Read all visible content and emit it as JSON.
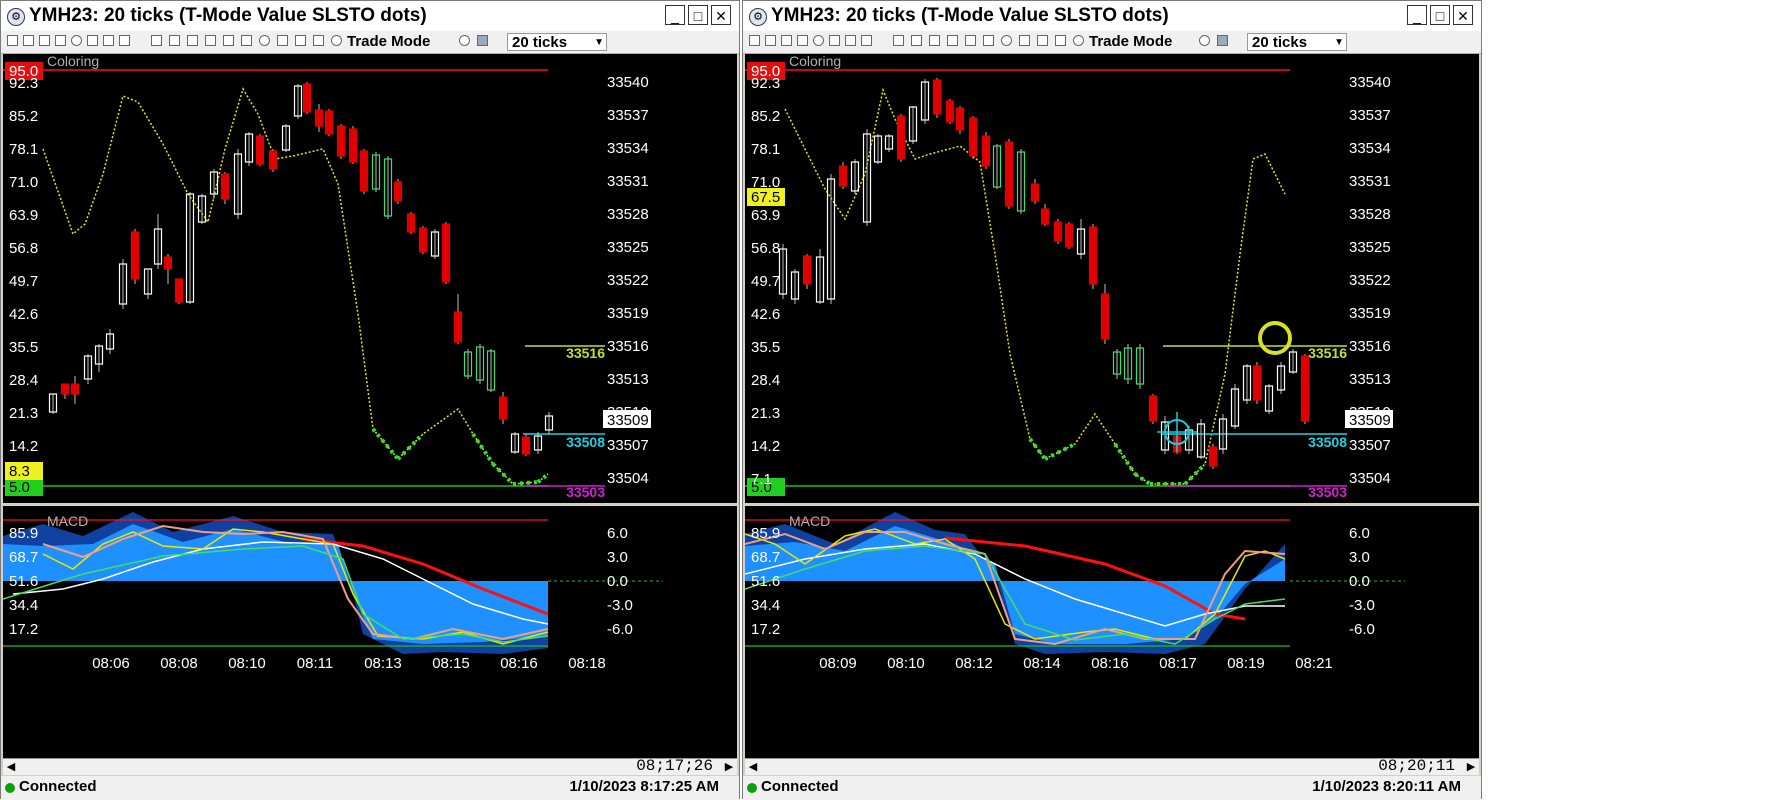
{
  "windows": [
    {
      "title": "YMH23: 20 ticks (T-Mode Value SLSTO dots)",
      "toolbar": {
        "mode_label": "Trade Mode",
        "interval": "20 ticks"
      },
      "price_panel": {
        "indicator_label": "Coloring",
        "left_axis_labels": [
          "92.3",
          "85.2",
          "78.1",
          "71.0",
          "63.9",
          "56.8",
          "49.7",
          "42.6",
          "35.5",
          "28.4",
          "21.3",
          "14.2"
        ],
        "right_axis_labels": [
          "33540",
          "33537",
          "33534",
          "33531",
          "33528",
          "33525",
          "33522",
          "33519",
          "33516",
          "33513",
          "33510",
          "33507",
          "33504"
        ],
        "upper_level_badge": "95.0",
        "lower_level_badge": "5.0",
        "current_osc_badge": "8.3",
        "last_price_badge": "33509",
        "level_line_labels": {
          "high": "33516",
          "mid": "33508",
          "low": "33503"
        }
      },
      "macd_panel": {
        "label": "MACD",
        "left_axis_labels": [
          "85.9",
          "68.7",
          "51.6",
          "34.4",
          "17.2"
        ],
        "right_axis_labels": [
          "6.0",
          "3.0",
          "0.0",
          "-3.0",
          "-6.0"
        ]
      },
      "time_axis_labels": [
        "08:06",
        "08:08",
        "08:10",
        "08:11",
        "08:13",
        "08:15",
        "08:16",
        "08:18"
      ],
      "scroll_time": "08;17;26",
      "status": {
        "connection": "Connected",
        "datetime": "1/10/2023 8:17:25 AM"
      }
    },
    {
      "title": "YMH23: 20 ticks (T-Mode Value SLSTO dots)",
      "toolbar": {
        "mode_label": "Trade Mode",
        "interval": "20 ticks"
      },
      "price_panel": {
        "indicator_label": "Coloring",
        "left_axis_labels": [
          "92.3",
          "85.2",
          "78.1",
          "71.0",
          "63.9",
          "56.8",
          "49.7",
          "42.6",
          "35.5",
          "28.4",
          "21.3",
          "14.2",
          "7.1"
        ],
        "right_axis_labels": [
          "33540",
          "33537",
          "33534",
          "33531",
          "33528",
          "33525",
          "33522",
          "33519",
          "33516",
          "33513",
          "33510",
          "33507",
          "33504"
        ],
        "upper_level_badge": "95.0",
        "lower_level_badge": "5.0",
        "current_osc_badge": "67.5",
        "last_price_badge": "33509",
        "level_line_labels": {
          "high": "33516",
          "mid": "33508",
          "low": "33503"
        }
      },
      "macd_panel": {
        "label": "MACD",
        "left_axis_labels": [
          "85.9",
          "68.7",
          "51.6",
          "34.4",
          "17.2"
        ],
        "right_axis_labels": [
          "6.0",
          "3.0",
          "0.0",
          "-3.0",
          "-6.0"
        ]
      },
      "time_axis_labels": [
        "08:09",
        "08:10",
        "08:12",
        "08:14",
        "08:16",
        "08:17",
        "08:19",
        "08:21"
      ],
      "scroll_time": "08;20;11",
      "status": {
        "connection": "Connected",
        "datetime": "1/10/2023 8:20:11 AM"
      }
    }
  ],
  "colors": {
    "chart_bg": "#000000",
    "up_candle": "#ffffff",
    "down_candle": "#e00000",
    "green_candle": "#40e070",
    "stoch_line": "#e8e800",
    "stoch_dots_oversold": "#30e030",
    "level_high": "#c0e030",
    "level_mid": "#20d0e0",
    "level_low": "#d020d0",
    "macd_area_light": "#1e90ff",
    "macd_area_dark": "#1040a0",
    "signal_red": "#ff1010"
  }
}
